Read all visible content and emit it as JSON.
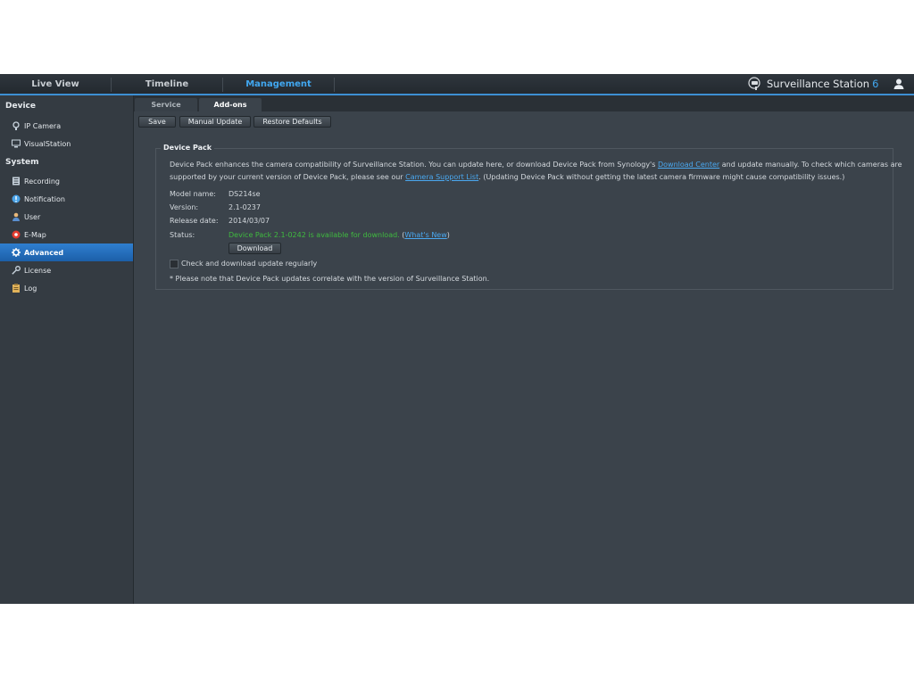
{
  "nav": {
    "live_view": "Live View",
    "timeline": "Timeline",
    "management": "Management"
  },
  "brand": {
    "name": "Surveillance Station",
    "version": "6"
  },
  "sidebar": {
    "device_title": "Device",
    "system_title": "System",
    "items": [
      {
        "label": "IP Camera",
        "icon": "camera-icon"
      },
      {
        "label": "VisualStation",
        "icon": "visualstation-icon"
      },
      {
        "label": "Recording",
        "icon": "recording-icon"
      },
      {
        "label": "Notification",
        "icon": "notification-icon"
      },
      {
        "label": "User",
        "icon": "user-icon"
      },
      {
        "label": "E-Map",
        "icon": "emap-icon"
      },
      {
        "label": "Advanced",
        "icon": "gear-icon",
        "active": true
      },
      {
        "label": "License",
        "icon": "key-icon"
      },
      {
        "label": "Log",
        "icon": "log-icon"
      }
    ]
  },
  "tabs": {
    "service": "Service",
    "addons": "Add-ons"
  },
  "toolbar": {
    "save": "Save",
    "manual_update": "Manual Update",
    "restore_defaults": "Restore Defaults"
  },
  "device_pack": {
    "legend": "Device Pack",
    "desc1_a": "Device Pack enhances the camera compatibility of Surveillance Station. You can update here, or download Device Pack from Synology's ",
    "desc1_link": "Download Center",
    "desc1_b": " and update manually. To check which cameras are",
    "desc2_a": "supported by your current version of Device Pack, please see our ",
    "desc2_link": "Camera Support List",
    "desc2_b": ". (Updating Device Pack without getting the latest camera firmware might cause compatibility issues.)",
    "model_label": "Model name:",
    "model_value": "DS214se",
    "version_label": "Version:",
    "version_value": "2.1-0237",
    "release_label": "Release date:",
    "release_value": "2014/03/07",
    "status_label": "Status:",
    "status_value": "Device Pack 2.1-0242 is available for download.",
    "status_open": " (",
    "whats_new": "What's New",
    "status_close": ")",
    "download": "Download",
    "checkbox_label": "Check and download update regularly",
    "note": "* Please note that Device Pack updates correlate with the version of Surveillance Station."
  },
  "colors": {
    "accent": "#41a7f0",
    "active_item": "#1f6bb8",
    "status_green": "#3fba3f"
  }
}
